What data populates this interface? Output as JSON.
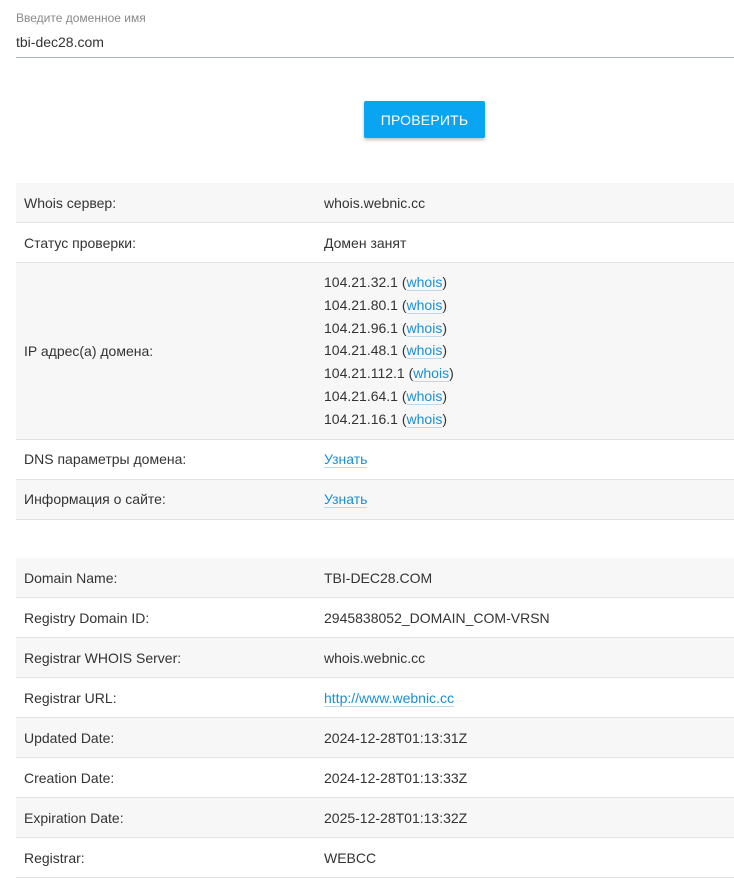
{
  "domain_input": {
    "label": "Введите доменное имя",
    "value": "tbi-dec28.com"
  },
  "check_button": {
    "label": "ПРОВЕРИТЬ"
  },
  "summary": {
    "whois_server": {
      "label": "Whois сервер:",
      "value": "whois.webnic.cc"
    },
    "status": {
      "label": "Статус проверки:",
      "value": "Домен занят"
    },
    "ips": {
      "label": "IP адрес(а) домена:",
      "items": [
        {
          "ip": "104.21.32.1",
          "link": "whois"
        },
        {
          "ip": "104.21.80.1",
          "link": "whois"
        },
        {
          "ip": "104.21.96.1",
          "link": "whois"
        },
        {
          "ip": "104.21.48.1",
          "link": "whois"
        },
        {
          "ip": "104.21.112.1",
          "link": "whois"
        },
        {
          "ip": "104.21.64.1",
          "link": "whois"
        },
        {
          "ip": "104.21.16.1",
          "link": "whois"
        }
      ]
    },
    "dns": {
      "label": "DNS параметры домена:",
      "link": "Узнать"
    },
    "site_info": {
      "label": "Информация о сайте:",
      "link": "Узнать"
    }
  },
  "whois": {
    "domain_name": {
      "label": "Domain Name:",
      "value": "TBI-DEC28.COM"
    },
    "registry_domain_id": {
      "label": "Registry Domain ID:",
      "value": "2945838052_DOMAIN_COM-VRSN"
    },
    "registrar_whois_server": {
      "label": "Registrar WHOIS Server:",
      "value": "whois.webnic.cc"
    },
    "registrar_url": {
      "label": "Registrar URL:",
      "value": "http://www.webnic.cc"
    },
    "updated_date": {
      "label": "Updated Date:",
      "value": "2024-12-28T01:13:31Z"
    },
    "creation_date": {
      "label": "Creation Date:",
      "value": "2024-12-28T01:13:33Z"
    },
    "expiration_date": {
      "label": "Expiration Date:",
      "value": "2025-12-28T01:13:32Z"
    },
    "registrar": {
      "label": "Registrar:",
      "value": "WEBCC"
    }
  }
}
